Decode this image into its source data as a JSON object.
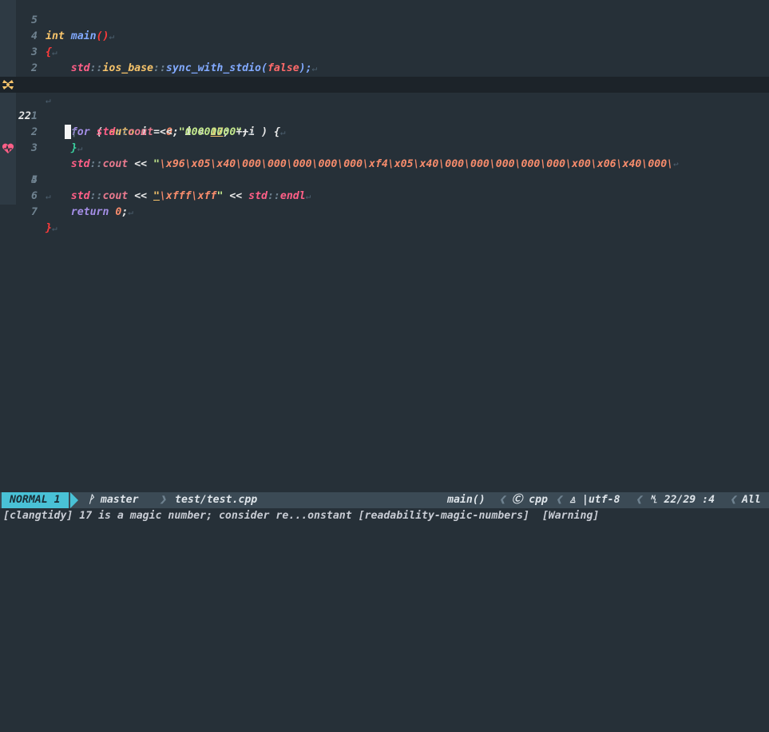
{
  "editor": {
    "current_line_number": "22",
    "relative_numbers": [
      "5",
      "4",
      "3",
      "2",
      "1",
      "1",
      "2",
      "3",
      "4",
      "5",
      "6",
      "7"
    ],
    "code": {
      "l1_type": "int",
      "l1_fn": "main",
      "l1_parens": "()",
      "l2": "{",
      "l3_ns": "std",
      "l3_sep": "::",
      "l3_type": "ios_base",
      "l3_fn": "sync_with_stdio",
      "l3_open": "(",
      "l3_arg": "false",
      "l3_close": ");",
      "l4_ns": "std",
      "l4_sep": "::",
      "l4_obj": "cin",
      "l4_dot": ".",
      "l4_fn": "tie",
      "l4_open": "(",
      "l4_arg": "nullptr",
      "l4_close": ");",
      "l6_for": "for",
      "l6_open": " ( ",
      "l6_auto": "auto",
      "l6_i": " i = ",
      "l6_zero": "0",
      "l6_mid": "; i < ",
      "l6_num": "17",
      "l6_end": "; ++i ) {",
      "l7_ns": "std",
      "l7_sep": "::",
      "l7_cout": "cout",
      "l7_op": " << ",
      "l7_str": "\"00000000\"",
      "l7_semi": ";",
      "l8": "}",
      "l9_ns": "std",
      "l9_sep": "::",
      "l9_cout": "cout",
      "l9_op": " << ",
      "l9_q": "\"",
      "l9_esc": "\\x96\\x05\\x40\\000\\000\\000\\000\\000\\xf4\\x05\\x40\\000\\000\\000\\000\\000\\x00\\x06\\x40\\000\\",
      "l10_ns": "std",
      "l10_sep": "::",
      "l10_cout": "cout",
      "l10_op": " << ",
      "l10_q": "\"",
      "l10_esc": "\\xfff\\xff",
      "l10_q2": "\"",
      "l10_op2": " << ",
      "l10_ns2": "std",
      "l10_sep2": "::",
      "l10_endl": "endl",
      "l12_return": "return",
      "l12_zero": "0",
      "l12_semi": ";",
      "l13": "}"
    },
    "eol_marker": "↵",
    "wrap_marker": "↩"
  },
  "statusline": {
    "mode": "NORMAL",
    "mode_num": "1",
    "branch_icon": "branch-icon",
    "branch": "master",
    "file": "test/test.cpp",
    "function": "main()",
    "filetype_icon": "cpp-logo-icon",
    "filetype": "cpp",
    "os_icon": "linux-icon",
    "encoding": "|utf-8",
    "position_icon": "line-number-icon",
    "position": "22/29 :4",
    "scroll": "All"
  },
  "message": "[clangtidy] 17 is a magic number; consider re...onstant [readability-magic-numbers]  [Warning]",
  "colors": {
    "background": "#263038",
    "keyword": "#a48ee6",
    "type": "#f7c46b",
    "function": "#82aaff",
    "namespace": "#ff5f87",
    "string": "#c3e88d",
    "escape": "#f78c6c",
    "mode_bg": "#49c1d6",
    "statusline_bg": "#3b4a55"
  }
}
